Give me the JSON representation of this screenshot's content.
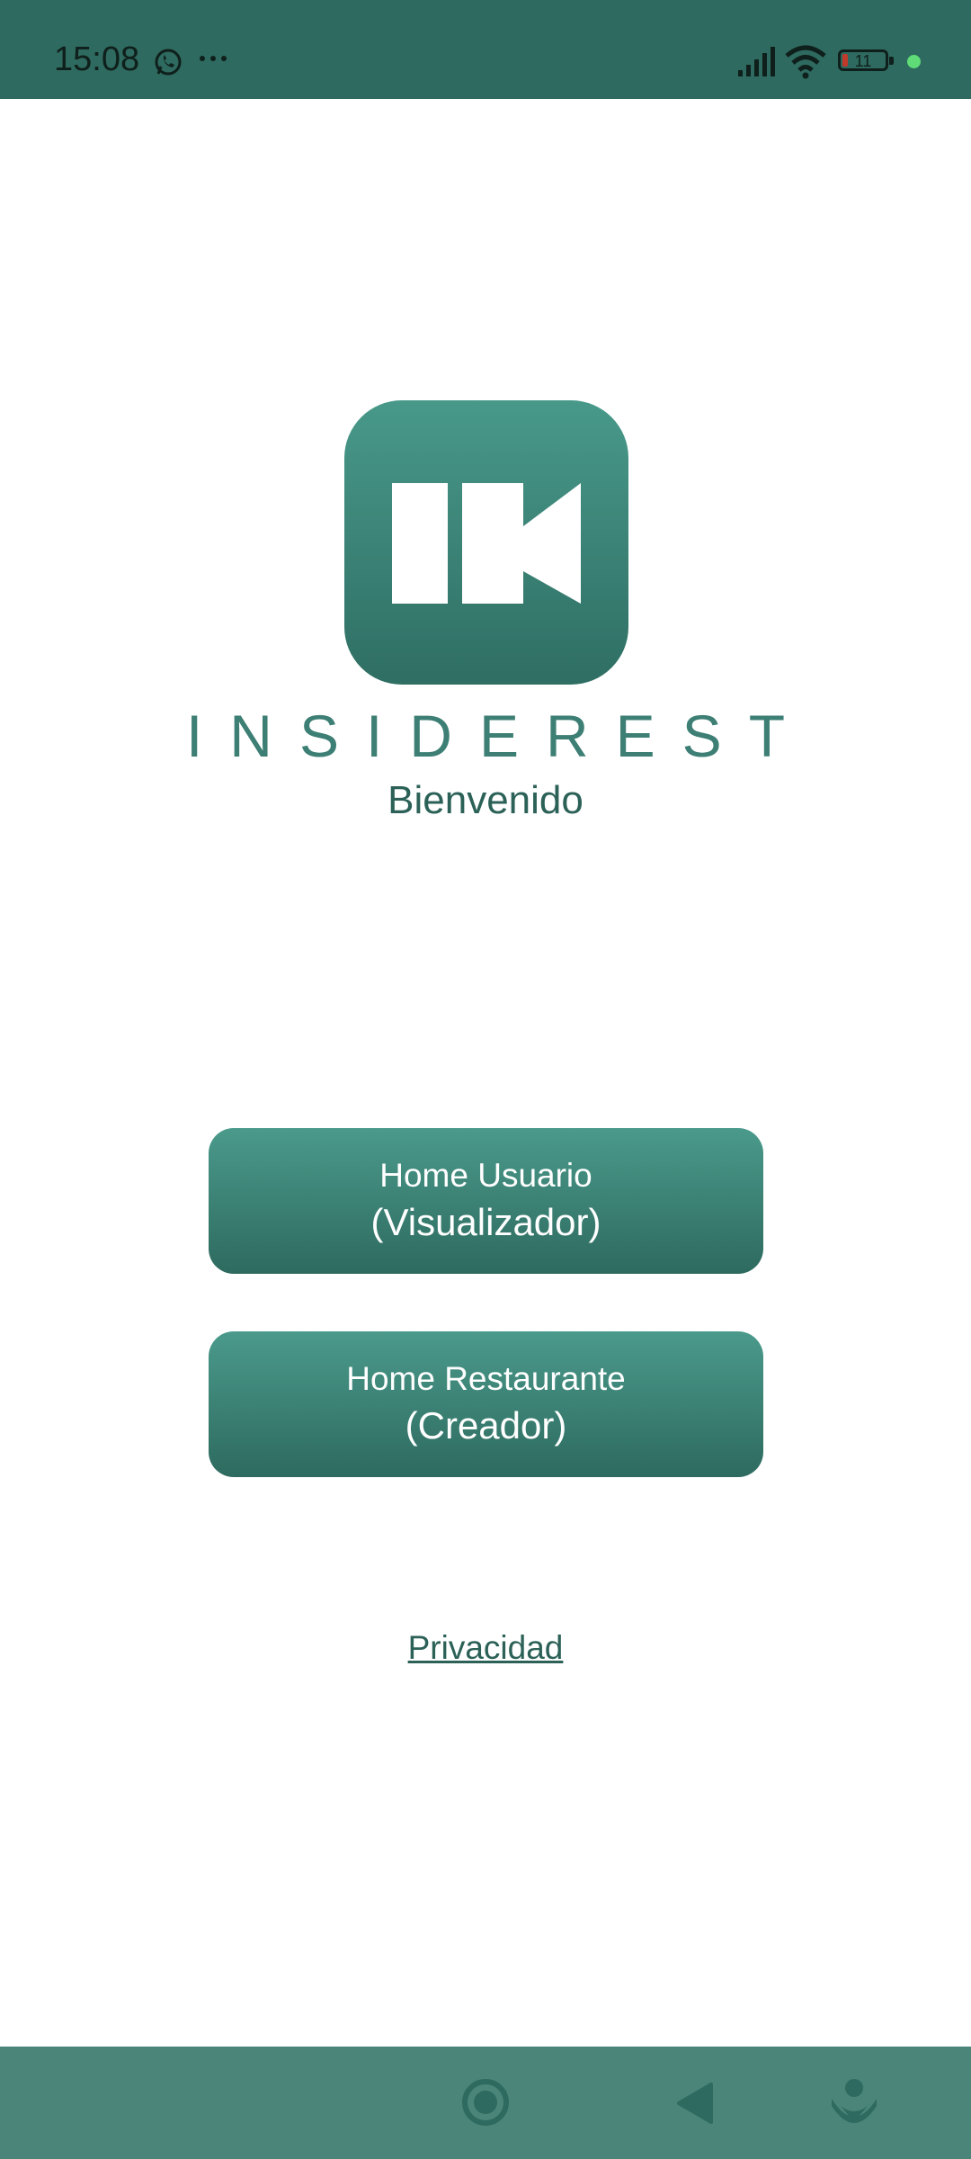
{
  "status_bar": {
    "time": "15:08",
    "battery_level": "11",
    "icons": [
      "whatsapp-icon",
      "more-dots-icon",
      "signal-icon",
      "wifi-icon",
      "battery-icon",
      "green-dot-indicator"
    ]
  },
  "app": {
    "logo_letters": "IN",
    "brand_name": "INSIDEREST",
    "welcome": "Bienvenido"
  },
  "buttons": {
    "user_home": {
      "line1": "Home Usuario",
      "line2": "(Visualizador)"
    },
    "restaurant_home": {
      "line1": "Home Restaurante",
      "line2": "(Creador)"
    }
  },
  "privacy_link": "Privacidad",
  "nav_bar": {
    "icons": [
      "recent-apps-icon",
      "home-icon",
      "back-icon",
      "assistant-icon"
    ]
  },
  "colors": {
    "primary": "#2e6a5f",
    "primary_light": "#48998a",
    "nav_bar": "#4b857a",
    "text_dark": "#2b6157",
    "battery_low": "#c0392b",
    "indicator": "#5fdc77"
  }
}
